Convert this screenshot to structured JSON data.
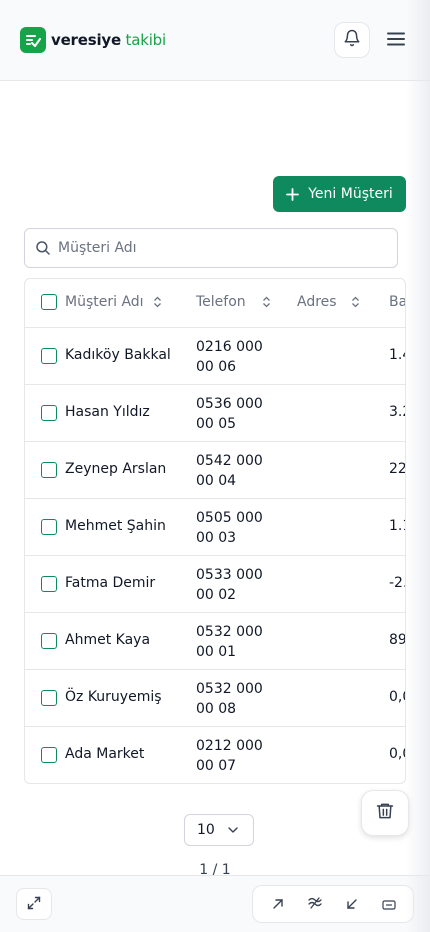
{
  "app": {
    "logo_bold": "veresiye",
    "logo_light": "takibi"
  },
  "icons": {
    "logo": "logo-check-icon",
    "bell": "bell-icon",
    "menu": "hamburger-menu-icon",
    "plus": "plus-icon",
    "search": "search-icon",
    "sort": "sort-icon",
    "trash": "trash-icon",
    "chevron": "chevron-down-icon"
  },
  "colors": {
    "brand": "#16a34a",
    "primary_button": "#0f8a5f"
  },
  "actions": {
    "new_customer": "Yeni Müşteri"
  },
  "search": {
    "placeholder": "Müşteri Adı",
    "value": ""
  },
  "table": {
    "columns": [
      "Müşteri Adı",
      "Telefon",
      "Adres",
      "Ba"
    ],
    "rows": [
      {
        "name": "Kadıköy Bakkal",
        "phone": "0216 000 00 06",
        "address": "",
        "balance": "1.4"
      },
      {
        "name": "Hasan Yıldız",
        "phone": "0536 000 00 05",
        "address": "",
        "balance": "3.2"
      },
      {
        "name": "Zeynep Arslan",
        "phone": "0542 000 00 04",
        "address": "",
        "balance": "22"
      },
      {
        "name": "Mehmet Şahin",
        "phone": "0505 000 00 03",
        "address": "",
        "balance": "1.1"
      },
      {
        "name": "Fatma Demir",
        "phone": "0533 000 00 02",
        "address": "",
        "balance": "-2."
      },
      {
        "name": "Ahmet Kaya",
        "phone": "0532 000 00 01",
        "address": "",
        "balance": "89"
      },
      {
        "name": "Öz Kuruyemiş",
        "phone": "0532 000 00 08",
        "address": "",
        "balance": "0,0"
      },
      {
        "name": "Ada Market",
        "phone": "0212 000 00 07",
        "address": "",
        "balance": "0,0"
      }
    ]
  },
  "pagination": {
    "page_size": "10",
    "page_info": "1 / 1"
  },
  "toolbar": {
    "tools": [
      "expand-icon",
      "arrow-up-right-icon",
      "stroke-icon",
      "arrow-down-left-icon",
      "keyboard-icon"
    ]
  }
}
